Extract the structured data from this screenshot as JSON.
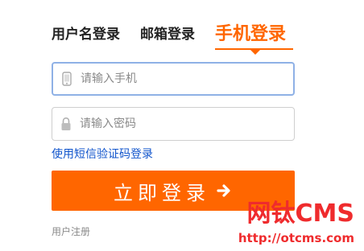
{
  "tabs": [
    {
      "label": "用户名登录"
    },
    {
      "label": "邮箱登录"
    },
    {
      "label": "手机登录",
      "active": true
    }
  ],
  "phone_field": {
    "placeholder": "请输入手机",
    "icon": "mobile-phone-icon"
  },
  "password_field": {
    "placeholder": "请输入密码",
    "icon": "lock-icon"
  },
  "sms_login_link": "使用短信验证码登录",
  "login_button": {
    "label": "立即登录",
    "icon": "arrow-right-icon"
  },
  "register_link": "用户注册",
  "watermark": {
    "title": "网钛CMS",
    "url": "http://otcms.com"
  },
  "colors": {
    "accent": "#ff6600",
    "link": "#1155cc",
    "input_focus_border": "#8fb1e6",
    "watermark": "#ef2b2d"
  }
}
